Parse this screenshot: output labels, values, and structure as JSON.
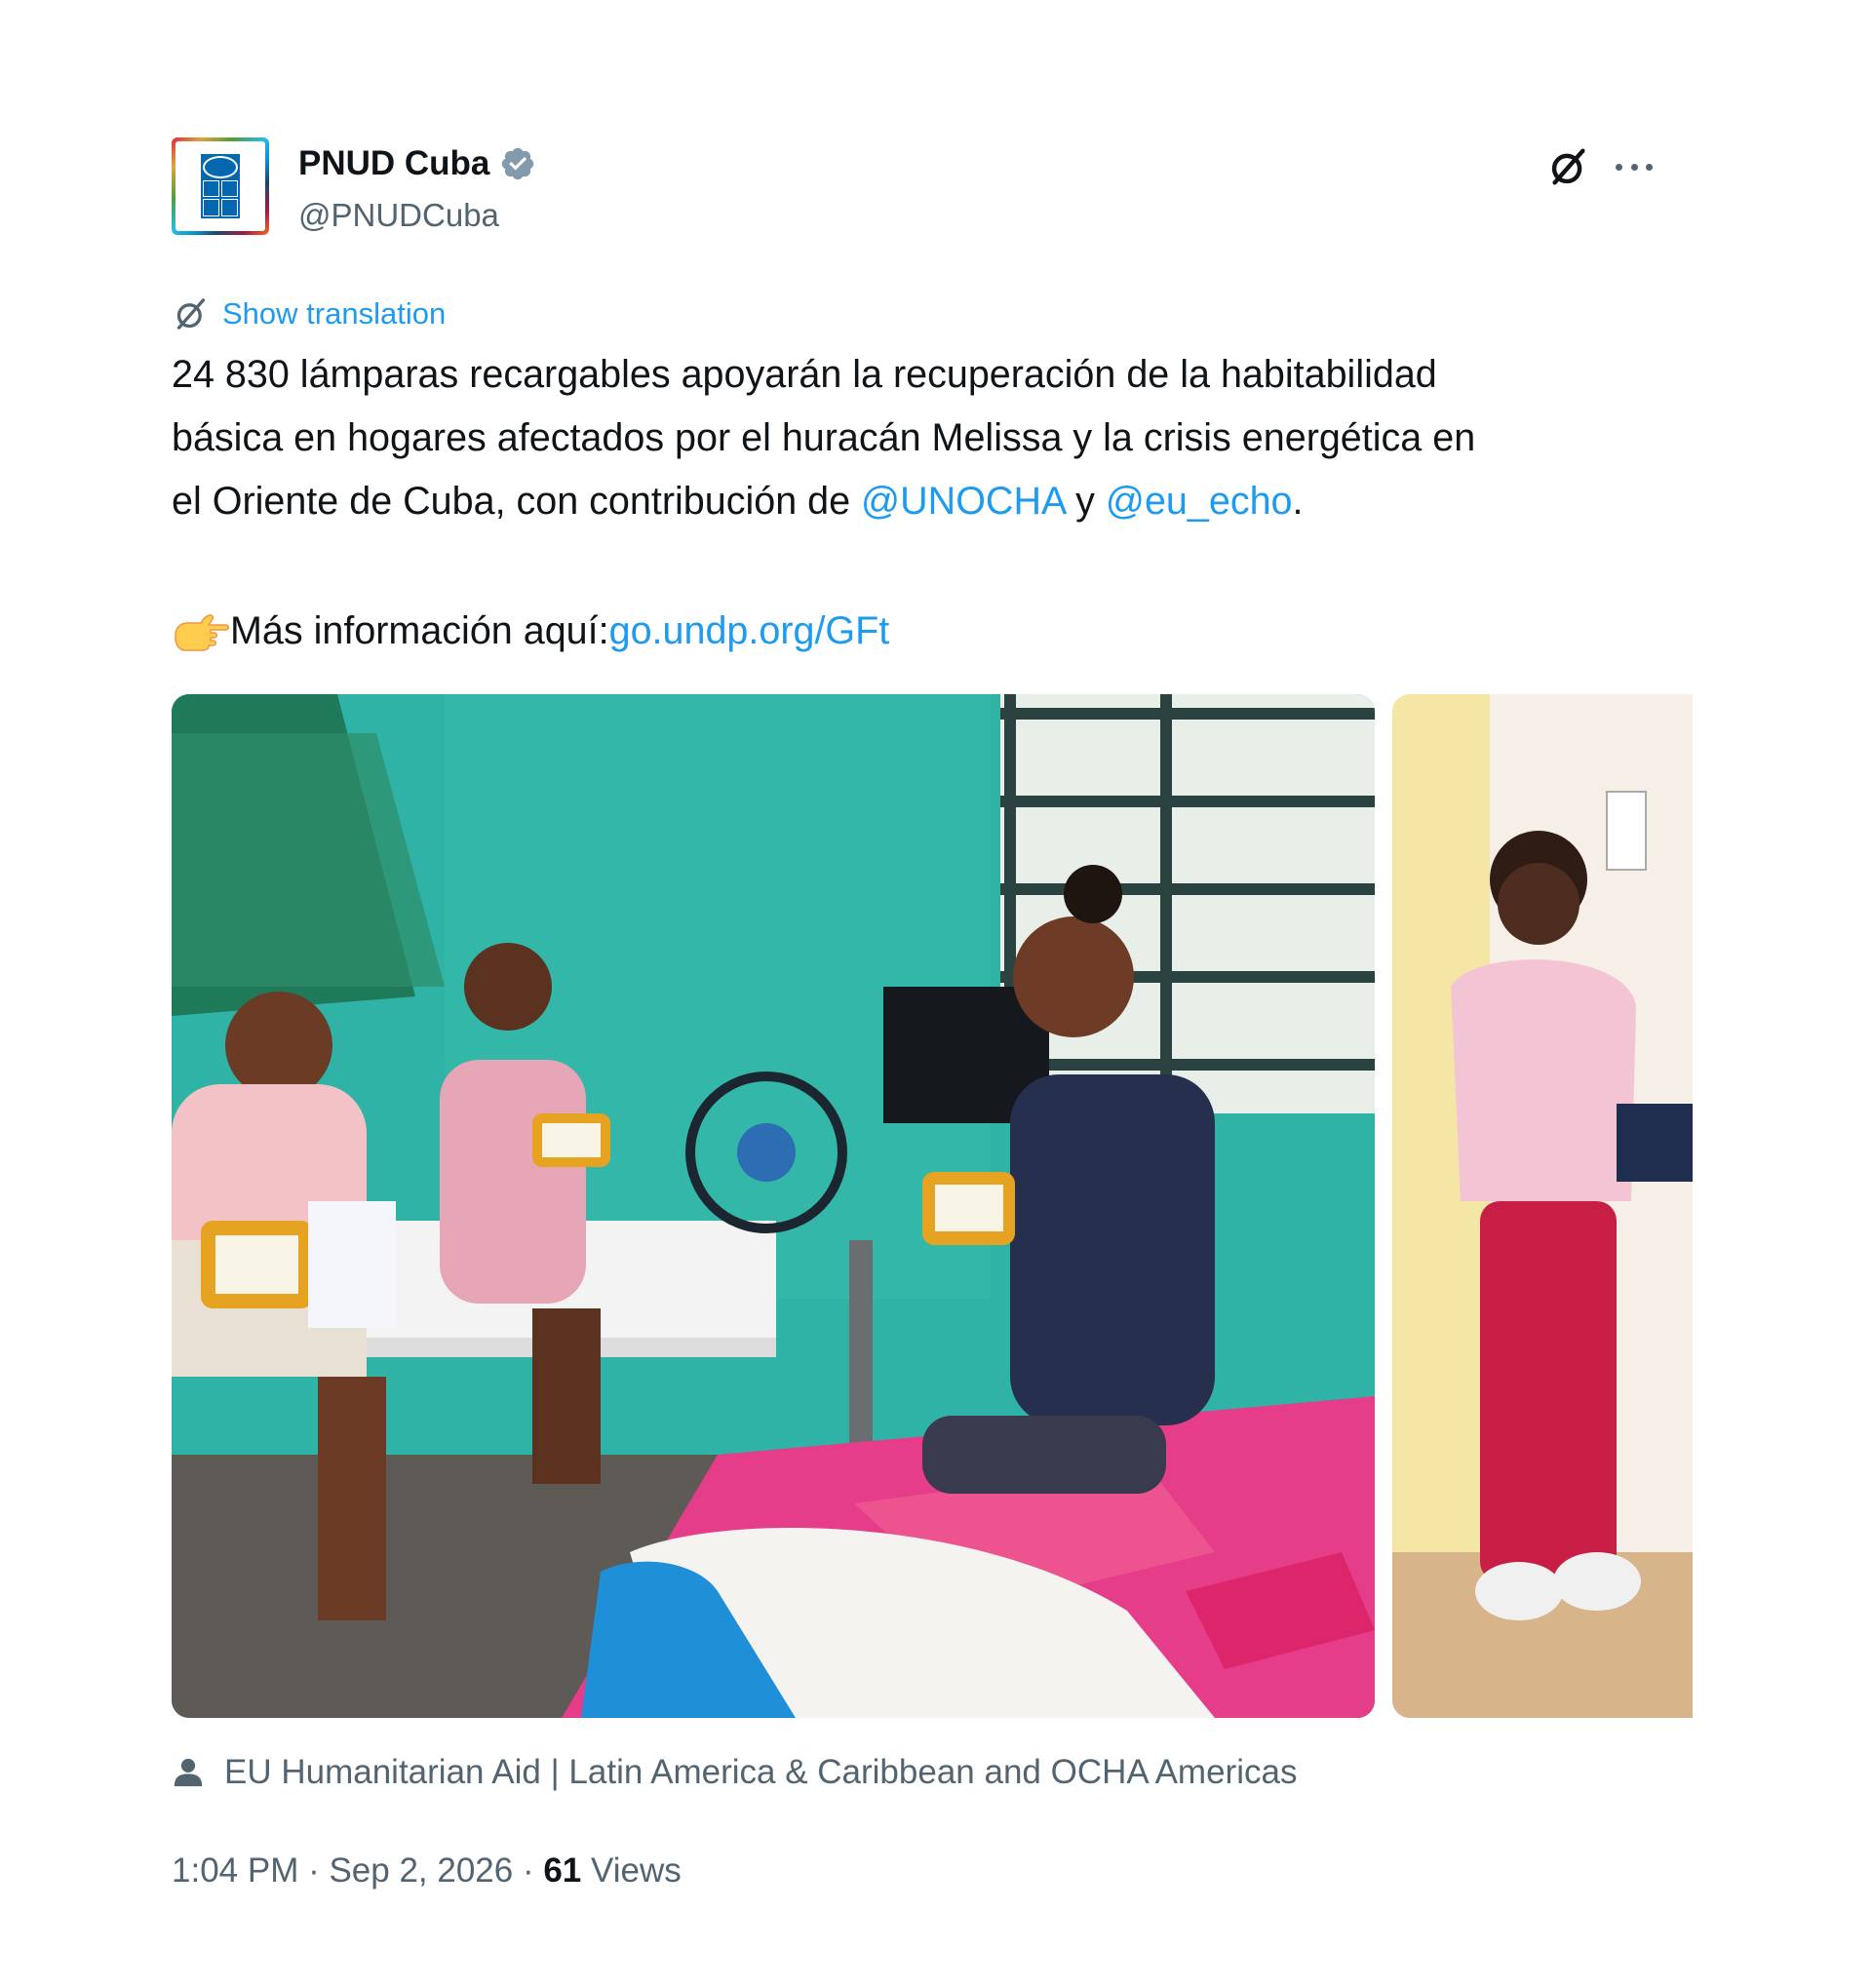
{
  "tweet": {
    "author": {
      "display_name": "PNUD Cuba",
      "handle": "@PNUDCuba",
      "verified": true,
      "avatar_icon": "undp-logo-icon"
    },
    "actions": {
      "grok_icon": "grok-icon",
      "more_icon": "more-icon"
    },
    "translation_label": "Show translation",
    "text": {
      "line1": "24 830 lámparas recargables apoyarán la recuperación de la habitabilidad",
      "line2": "básica en hogares afectados por el huracán Melissa y la crisis energética en",
      "line3_prefix": "el Oriente de Cuba, con contribución de ",
      "mention1": "@UNOCHA",
      "line3_middle": " y ",
      "mention2": "@eu_echo",
      "line3_suffix": ".",
      "more_info_label": "Más información aquí: ",
      "more_info_link": "go.undp.org/GFt"
    },
    "media": [
      {
        "name": "photo-women-with-lamps",
        "icon": "photo"
      },
      {
        "name": "photo-woman-holding-lamp-box",
        "icon": "photo"
      }
    ],
    "tagged_label": "EU Humanitarian Aid | Latin America & Caribbean and OCHA Americas",
    "timestamp": "1:04 PM · Sep 2, 2026 · ",
    "views_count": "61",
    "views_label": " Views",
    "colors": {
      "link": "#1d9bf0",
      "secondary_text": "#536471",
      "primary_text": "#0f1419",
      "verified_badge": "#829aab"
    }
  }
}
